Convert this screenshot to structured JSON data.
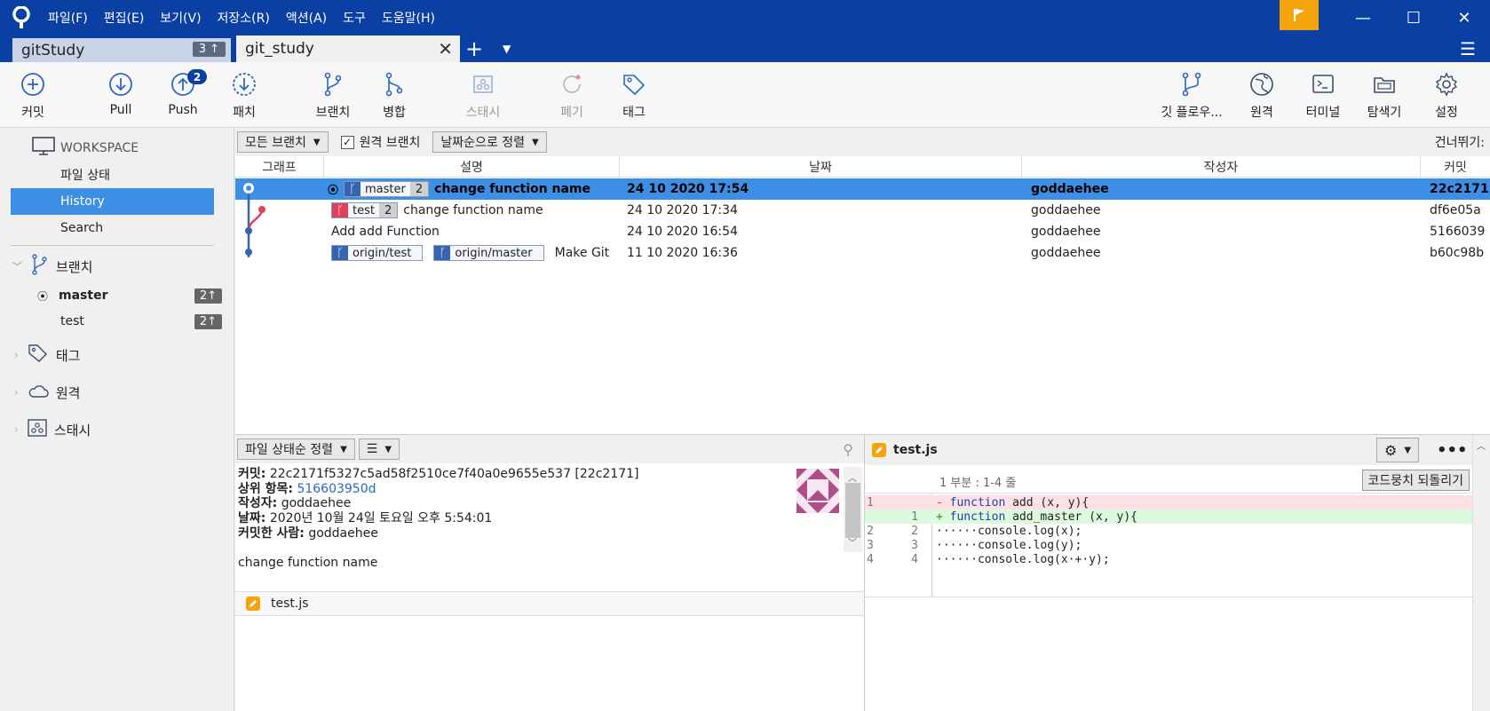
{
  "menu": [
    "파일(F)",
    "편집(E)",
    "보기(V)",
    "저장소(R)",
    "액션(A)",
    "도구",
    "도움말(H)"
  ],
  "tabs": [
    {
      "label": "gitStudy",
      "badge": "3 ↑"
    },
    {
      "label": "git_study"
    }
  ],
  "toolbar": {
    "commit": "커밋",
    "pull": "Pull",
    "push": "Push",
    "push_badge": "2",
    "patch": "패치",
    "branch": "브랜치",
    "merge": "병합",
    "stash": "스태시",
    "discard": "폐기",
    "tag": "태그",
    "gitflow": "깃 플로우...",
    "remote": "원격",
    "terminal": "터미널",
    "explorer": "탐색기",
    "settings": "설정"
  },
  "sidebar": {
    "workspace": "WORKSPACE",
    "file_status": "파일 상태",
    "history": "History",
    "search": "Search",
    "branches_title": "브랜치",
    "branches": [
      {
        "name": "master",
        "count": "2↑"
      },
      {
        "name": "test",
        "count": "2↑"
      }
    ],
    "tags": "태그",
    "remotes": "원격",
    "stash": "스태시"
  },
  "filter": {
    "all_branches": "모든 브랜치",
    "remote_branches": "원격 브랜치",
    "sort": "날짜순으로 정렬",
    "skip": "건너뛰기:"
  },
  "columns": [
    "그래프",
    "설명",
    "날짜",
    "작성자",
    "커밋"
  ],
  "commits": [
    {
      "refs": [
        {
          "name": "master",
          "count": "2",
          "color": "blue"
        }
      ],
      "message": "change function name",
      "date": "24 10 2020 17:54",
      "author": "goddaehee",
      "hash": "22c2171"
    },
    {
      "refs": [
        {
          "name": "test",
          "count": "2",
          "color": "red"
        }
      ],
      "message": "change function name",
      "date": "24 10 2020 17:34",
      "author": "goddaehee",
      "hash": "df6e05a"
    },
    {
      "refs": [],
      "message": "Add add Function",
      "date": "24 10 2020 16:54",
      "author": "goddaehee",
      "hash": "5166039"
    },
    {
      "refs": [
        {
          "name": "origin/test",
          "color": "blue"
        },
        {
          "name": "origin/master",
          "color": "blue"
        }
      ],
      "message": "Make Git",
      "date": "11 10 2020 16:36",
      "author": "goddaehee",
      "hash": "b60c98b"
    }
  ],
  "details": {
    "sort_label": "파일 상태순 정렬",
    "commit_label": "커밋:",
    "commit_value": "22c2171f5327c5ad58f2510ce7f40a0e9655e537 [22c2171]",
    "parent_label": "상위 항목:",
    "parent_value": "516603950d",
    "author_label": "작성자:",
    "author_value": "goddaehee",
    "date_label": "날짜:",
    "date_value": "2020년 10월 24일 토요일 오후 5:54:01",
    "committer_label": "커밋한 사람:",
    "committer_value": "goddaehee",
    "message": "change function name",
    "file": "test.js"
  },
  "diff": {
    "file": "test.js",
    "hunk": "1 부분 : 1-4 줄",
    "revert": "코드뭉치 되돌리기",
    "lines": [
      {
        "n1": "1",
        "n2": "",
        "type": "del",
        "prefix": "- ",
        "kw": "function",
        "rest": " add (x, y){"
      },
      {
        "n1": "",
        "n2": "1",
        "type": "add",
        "prefix": "+ ",
        "kw": "function",
        "rest": " add_master (x, y){"
      },
      {
        "n1": "2",
        "n2": "2",
        "type": "ctx",
        "prefix": "",
        "kw": "",
        "rest": "······console.log(x);"
      },
      {
        "n1": "3",
        "n2": "3",
        "type": "ctx",
        "prefix": "",
        "kw": "",
        "rest": "······console.log(y);"
      },
      {
        "n1": "4",
        "n2": "4",
        "type": "ctx",
        "prefix": "",
        "kw": "",
        "rest": "······console.log(x·+·y);"
      }
    ]
  },
  "colors": {
    "titlebar": "#0a3fa3",
    "selection": "#3c8fe4",
    "flag": "#f4a50a",
    "branch_blue": "#3565b0",
    "branch_red": "#e0405e"
  }
}
